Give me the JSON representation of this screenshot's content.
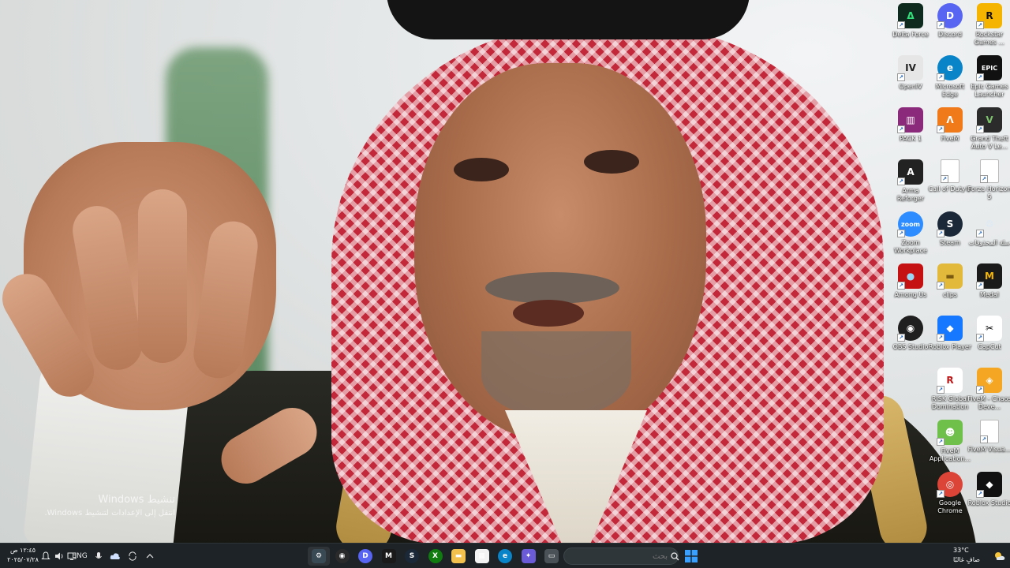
{
  "watermark": {
    "title": "تنشيط Windows",
    "subtitle": "انتقل إلى الإعدادات لتنشيط Windows."
  },
  "desktop_icons": [
    {
      "label": "Delta Force",
      "glyph": "Δ",
      "color": "#0e2a1f",
      "fg": "#31e07a"
    },
    {
      "label": "Discord",
      "glyph": "D",
      "color": "#5865f2",
      "round": true
    },
    {
      "label": "Rockstar Games ...",
      "glyph": "R",
      "color": "#f4b400",
      "fg": "#111"
    },
    {
      "label": "OpenIV",
      "glyph": "IV",
      "color": "#e6e6e6",
      "fg": "#222"
    },
    {
      "label": "Microsoft Edge",
      "glyph": "e",
      "color": "#0a84c9",
      "round": true
    },
    {
      "label": "Epic Games Launcher",
      "glyph": "EPIC",
      "color": "#111111"
    },
    {
      "label": "PACK 1",
      "glyph": "▥",
      "color": "#8b2a7a"
    },
    {
      "label": "FiveM",
      "glyph": "Λ",
      "color": "#f07a1a"
    },
    {
      "label": "Grand Theft Auto V Le...",
      "glyph": "V",
      "color": "#2b2b2b",
      "fg": "#7cc36b"
    },
    {
      "label": "Arma Reforger",
      "glyph": "A",
      "color": "#222222"
    },
    {
      "label": "Call of Duty®",
      "doc": true
    },
    {
      "label": "Forza Horizon 5",
      "doc": true
    },
    {
      "label": "Zoom Workplace",
      "glyph": "zoom",
      "color": "#2d8cff",
      "round": true
    },
    {
      "label": "Steam",
      "glyph": "S",
      "color": "#1b2838",
      "round": true
    },
    {
      "label": "سلة المحذوفات",
      "glyph": "♲",
      "color": "transparent",
      "fg": "#cfe8ff"
    },
    {
      "label": "Among Us",
      "glyph": "●",
      "color": "#c51111",
      "fg": "#9ad7f4"
    },
    {
      "label": "clips",
      "glyph": "▬",
      "color": "#e2b93b",
      "fg": "#7a5a12"
    },
    {
      "label": "Medal",
      "glyph": "M",
      "color": "#1a1a1a",
      "fg": "#f5b700"
    },
    {
      "label": "OBS Studio",
      "glyph": "◉",
      "color": "#1f1f1f",
      "round": true
    },
    {
      "label": "Roblox Player",
      "glyph": "◆",
      "color": "#1677ff"
    },
    {
      "label": "CapCut",
      "glyph": "✂",
      "color": "#ffffff",
      "fg": "#000"
    },
    {
      "label": "RISK Global Domination",
      "glyph": "R",
      "color": "#ffffff",
      "fg": "#c01818"
    },
    {
      "label": "FiveM - Chaos Deve...",
      "glyph": "◈",
      "color": "#f5a623"
    },
    {
      "label": "FiveM Application...",
      "glyph": "☻",
      "color": "#6ec04a"
    },
    {
      "label": "FiveM Visua...",
      "doc": true
    },
    {
      "label": "Google Chrome",
      "glyph": "◎",
      "color": "#db4437",
      "round": true
    },
    {
      "label": "Roblox Studio",
      "glyph": "◆",
      "color": "#111111"
    }
  ],
  "taskbar": {
    "apps": [
      {
        "name": "settings-taskbar-app",
        "glyph": "⚙",
        "color": "#3a4a55",
        "active": true
      },
      {
        "name": "obs-taskbar-app",
        "glyph": "◉",
        "color": "#2a2a2a",
        "round": true
      },
      {
        "name": "discord-taskbar-app",
        "glyph": "D",
        "color": "#5865f2",
        "round": true
      },
      {
        "name": "medal-taskbar-app",
        "glyph": "M",
        "color": "#1a1a1a"
      },
      {
        "name": "steam-taskbar-app",
        "glyph": "S",
        "color": "#1b2838",
        "round": true
      },
      {
        "name": "xbox-taskbar-app",
        "glyph": "X",
        "color": "#107c10",
        "round": true
      },
      {
        "name": "file-explorer-taskbar-app",
        "glyph": "▬",
        "color": "#f2c14e"
      },
      {
        "name": "microsoft-store-taskbar-app",
        "glyph": "▦",
        "color": "#f3f3f3"
      },
      {
        "name": "edge-taskbar-app",
        "glyph": "e",
        "color": "#0a84c9",
        "round": true
      },
      {
        "name": "copilot-taskbar-app",
        "glyph": "✦",
        "color": "#6b5bd9"
      },
      {
        "name": "task-view-taskbar-app",
        "glyph": "▭",
        "color": "#4a5257"
      }
    ],
    "search_placeholder": "بحث",
    "start_glyph": "⊞",
    "language": "ENG",
    "clock_time": "١٢:٤٥ ص",
    "clock_date": "٢٠٢٥/٠٧/٢٨",
    "weather_temp": "33°C",
    "weather_desc": "صافٍ غالبًا",
    "colors": {
      "taskbar_bg": "#1d2326",
      "accent": "#0a84c9"
    }
  }
}
